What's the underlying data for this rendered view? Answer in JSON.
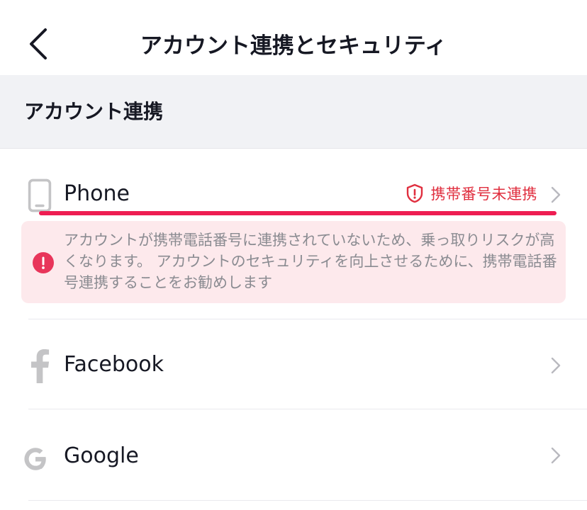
{
  "header": {
    "title": "アカウント連携とセキュリティ",
    "back_icon": "chevron-left-icon"
  },
  "section": {
    "title": "アカウント連携"
  },
  "accounts": [
    {
      "label": "Phone",
      "icon": "phone-icon",
      "status": "携帯番号未連携",
      "status_icon": "shield-alert-icon",
      "status_color": "#e02f3f"
    },
    {
      "label": "Facebook",
      "icon": "facebook-icon"
    },
    {
      "label": "Google",
      "icon": "google-icon"
    }
  ],
  "warning": {
    "text": "アカウントが携帯電話番号に連携されていないため、乗っ取りリスクが高くなります。 アカウントのセキュリティを向上させるために、携帯電話番号連携することをお勧めします",
    "background": "#fde9ec",
    "icon": "exclamation-circle-icon",
    "icon_color": "#e8355a"
  },
  "colors": {
    "accent": "#ee1d52",
    "section_bg": "#f1f2f5",
    "icon_gray": "#c4c4c6"
  }
}
